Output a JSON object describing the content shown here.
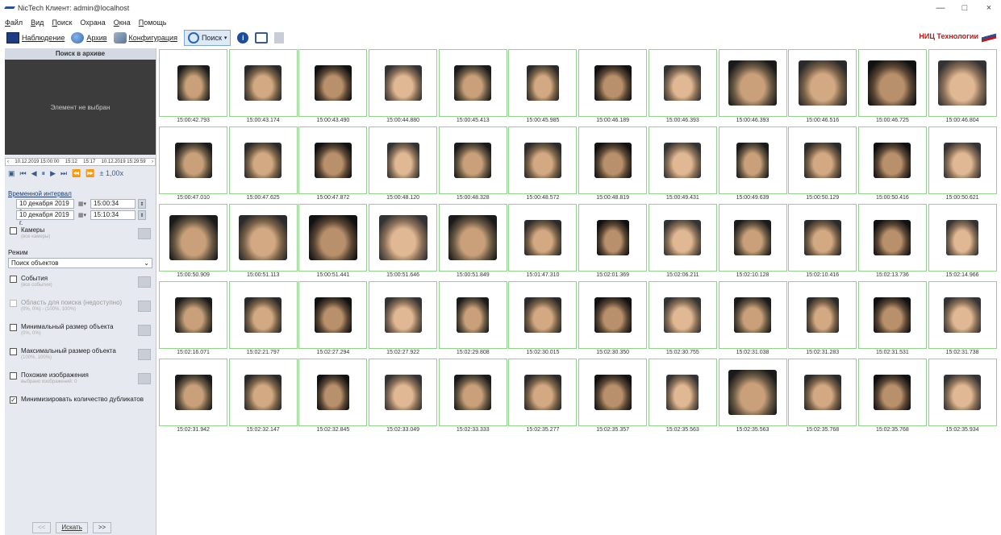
{
  "window": {
    "title": "NicTech Клиент: admin@localhost",
    "controls": [
      "—",
      "□",
      "×"
    ]
  },
  "menu": [
    {
      "u": "Ф",
      "rest": "айл"
    },
    {
      "u": "В",
      "rest": "ид"
    },
    {
      "u": "П",
      "rest": "оиск"
    },
    {
      "u": "",
      "rest": "Охрана"
    },
    {
      "u": "О",
      "rest": "кна"
    },
    {
      "u": "П",
      "rest": "омощь"
    }
  ],
  "toolbar": {
    "monitor": "Наблюдение",
    "archive": "Архив",
    "config": "Конфигурация",
    "search": "Поиск",
    "brand": "НИЦ Технологии"
  },
  "left": {
    "header": "Поиск в архиве",
    "preview_text": "Элемент не выбран",
    "timeline_left": "10.12.2019 15:00:00",
    "timeline_mid1": "15:12",
    "timeline_mid2": "15:17",
    "timeline_right": "10.12.2019 15:29:59",
    "speed": "± 1,00x",
    "interval_label": "Временной интервал",
    "date_from": "10 декабря  2019 г.",
    "time_from": "15:00:34",
    "date_to": "10 декабря  2019 г.",
    "time_to": "15:10:34",
    "cameras_label": "Камеры",
    "cameras_sub": "(все камеры)",
    "mode_label": "Режим",
    "mode_value": "Поиск объектов",
    "events_label": "События",
    "events_sub": "(все события)",
    "area_label": "Область для поиска (недоступно)",
    "area_sub": "(0%, 0%) - (100%, 100%)",
    "min_size_label": "Минимальный размер объекта",
    "min_size_sub": "(0%, 0%)",
    "max_size_label": "Максимальный размер объекта",
    "max_size_sub": "(100%, 100%)",
    "similar_label": "Похожие изображения",
    "similar_sub": "выбрано изображений: 0",
    "dedup_label": "Минимизировать количество дубликатов",
    "prev_btn": "<<",
    "search_btn": "Искать",
    "next_btn": ">>"
  },
  "results": [
    "15:00:42.793",
    "15:00:43.174",
    "15:00:43.490",
    "15:00:44.880",
    "15:00:45.413",
    "15:00:45.985",
    "15:00:46.189",
    "15:00:46.393",
    "15:00:46.393",
    "15:00:46.516",
    "15:00:46.725",
    "15:00:46.804",
    "15:00:47.010",
    "15:00:47.625",
    "15:00:47.872",
    "15:00:48.120",
    "15:00:48.328",
    "15:00:48.572",
    "15:00:48.819",
    "15:00:49.431",
    "15:00:49.639",
    "15:00:50.129",
    "15:00:50.416",
    "15:00:50.621",
    "15:00:50.909",
    "15:00:51.113",
    "15:00:51.441",
    "15:00:51.646",
    "15:00:51.849",
    "15:01:47.310",
    "15:02:01.369",
    "15:02:06.211",
    "15:02:10.128",
    "15:02:10.416",
    "15:02:13.736",
    "15:02:14.966",
    "15:02:16.071",
    "15:02:21.797",
    "15:02:27.294",
    "15:02:27.922",
    "15:02:29.808",
    "15:02:30.015",
    "15:02:30.350",
    "15:02:30.755",
    "15:02:31.038",
    "15:02:31.283",
    "15:02:31.531",
    "15:02:31.738",
    "15:02:31.942",
    "15:02:32.147",
    "15:02:32.845",
    "15:02:33.049",
    "15:02:33.333",
    "15:02:35.277",
    "15:02:35.357",
    "15:02:35.563",
    "15:02:35.563",
    "15:02:35.768",
    "15:02:35.768",
    "15:02:35.934"
  ]
}
